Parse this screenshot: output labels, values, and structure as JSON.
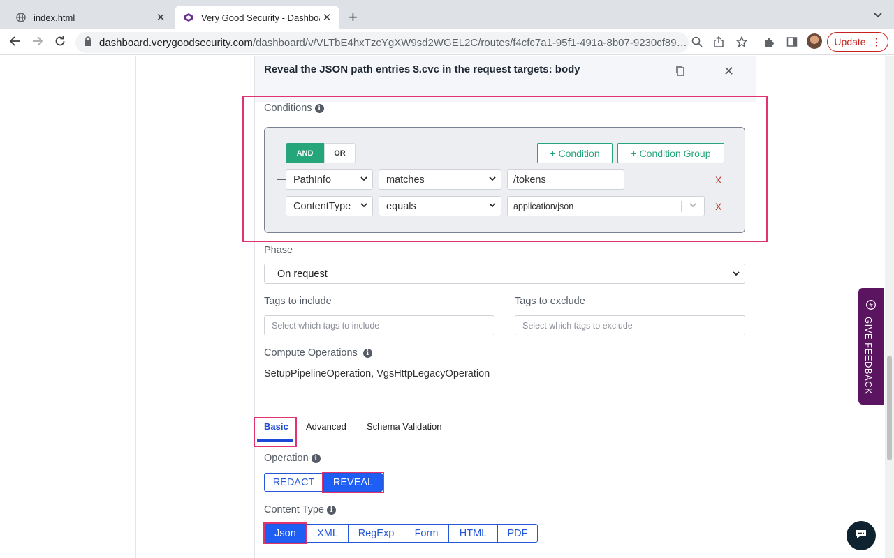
{
  "browser": {
    "tabs": [
      {
        "title": "index.html",
        "icon": "globe-icon"
      },
      {
        "title": "Very Good Security - Dashboard",
        "icon": "vgs-logo-icon"
      }
    ],
    "url_host": "dashboard.verygoodsecurity.com",
    "url_path": "/dashboard/v/VLTbE4hxTzcYgXW9sd2WGEL2C/routes/f4cfc7a1-95f1-491a-8b07-9230cf89…",
    "update_label": "Update"
  },
  "panel": {
    "title": "Reveal the JSON path entries $.cvc in the request targets: body"
  },
  "conditions": {
    "label": "Conditions",
    "and_label": "AND",
    "or_label": "OR",
    "add_condition": "+ Condition",
    "add_group": "+ Condition Group",
    "rows": [
      {
        "field": "PathInfo",
        "operator": "matches",
        "value": "/tokens"
      },
      {
        "field": "ContentType",
        "operator": "equals",
        "value": "application/json"
      }
    ],
    "delete_label": "X"
  },
  "phase": {
    "label": "Phase",
    "value": "On request"
  },
  "tags": {
    "include_label": "Tags to include",
    "include_placeholder": "Select which tags to include",
    "exclude_label": "Tags to exclude",
    "exclude_placeholder": "Select which tags to exclude"
  },
  "compute": {
    "label": "Compute Operations",
    "value": "SetupPipelineOperation, VgsHttpLegacyOperation"
  },
  "tabs": {
    "basic": "Basic",
    "advanced": "Advanced",
    "schema": "Schema Validation"
  },
  "operation": {
    "label": "Operation",
    "redact": "REDACT",
    "reveal": "REVEAL"
  },
  "content_type": {
    "label": "Content Type",
    "options": [
      "Json",
      "XML",
      "RegExp",
      "Form",
      "HTML",
      "PDF"
    ]
  },
  "feedback": {
    "label": "GIVE FEEDBACK"
  },
  "colors": {
    "accent_green": "#24a67a",
    "accent_blue": "#1f5ef5",
    "highlight": "#e0336f",
    "feedback_bg": "#5b1560"
  }
}
